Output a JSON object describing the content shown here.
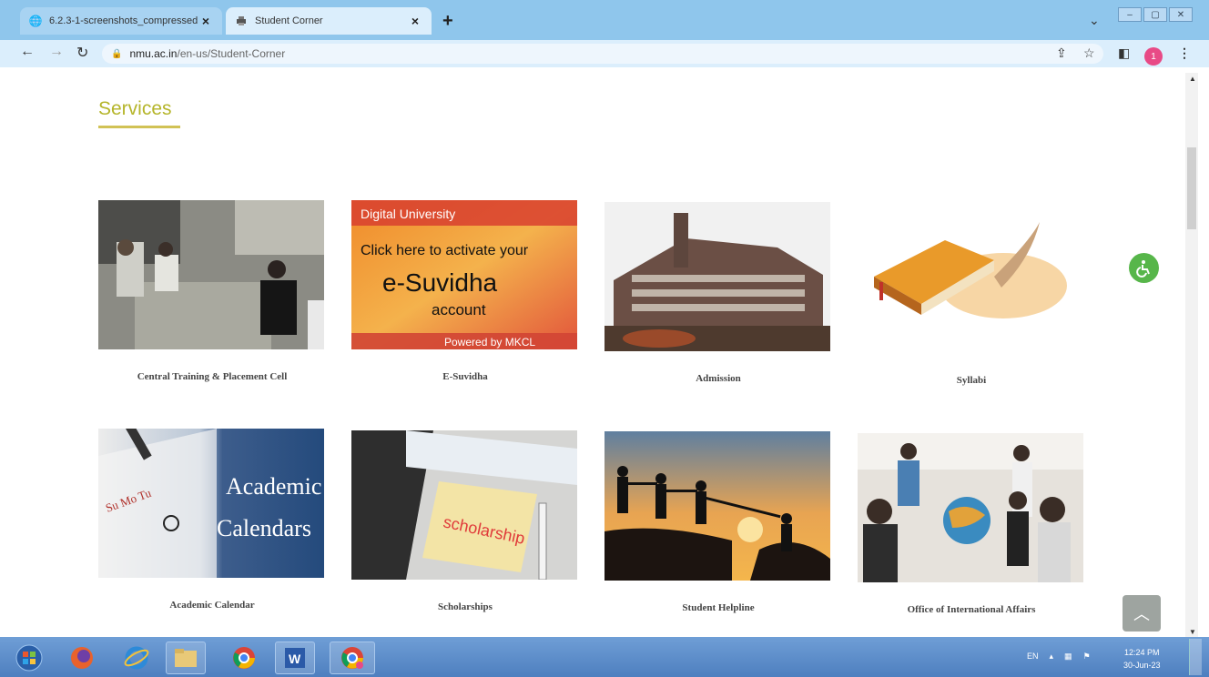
{
  "browser": {
    "tabs": [
      {
        "title": "6.2.3-1-screenshots_compressed",
        "active": false,
        "icon": "globe-icon"
      },
      {
        "title": "Student Corner",
        "active": true,
        "icon": "printer-icon"
      }
    ],
    "url_host": "nmu.ac.in",
    "url_path": "/en-us/Student-Corner",
    "profile_initial": "1"
  },
  "page": {
    "section_title": "Services",
    "services": [
      {
        "label": "Central Training & Placement Cell",
        "image": "placement-meeting-photo"
      },
      {
        "label": "E-Suvidha",
        "image": "esuvidha-banner"
      },
      {
        "label": "Admission",
        "image": "university-building-photo"
      },
      {
        "label": "Syllabi",
        "image": "book-and-quill-image"
      },
      {
        "label": "Academic Calendar",
        "image": "academic-calendar-banner"
      },
      {
        "label": "Scholarships",
        "image": "scholarship-note-image"
      },
      {
        "label": "Student Helpline",
        "image": "helping-hands-silhouette"
      },
      {
        "label": "Office of International Affairs",
        "image": "students-globe-photo"
      }
    ],
    "esuvidha_banner": {
      "line1": "Digital University",
      "line2": "Click here to activate your",
      "line3": "e-Suvidha",
      "line4": "account",
      "line5": "Powered by MKCL"
    },
    "calendar_banner": {
      "line1": "Academic",
      "line2": "Calendars",
      "days": "Su Mo Tu"
    },
    "scholarship_note": "scholarship"
  },
  "taskbar": {
    "language": "EN",
    "time": "12:24 PM",
    "date": "30-Jun-23"
  },
  "colors": {
    "accent_title": "#b5b52a",
    "tabbar": "#8fc6ec",
    "taskbar": "#5a8ac8",
    "accessibility": "#57b64a"
  }
}
